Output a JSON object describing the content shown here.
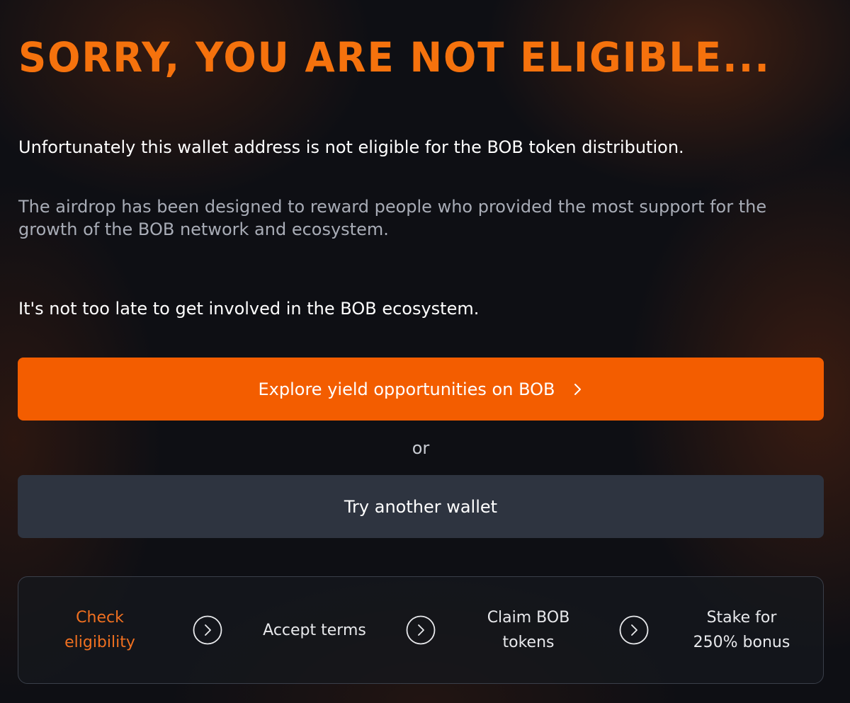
{
  "header": {
    "title": "SORRY, YOU ARE NOT ELIGIBLE..."
  },
  "content": {
    "lead": "Unfortunately this wallet address is not eligible for the BOB token distribution.",
    "explanation": "The airdrop has been designed to reward people who provided the most support for the growth of the BOB network and ecosystem.",
    "involve": "It's not too late to get involved in the BOB ecosystem."
  },
  "actions": {
    "primary_label": "Explore yield opportunities on BOB",
    "primary_icon": "chevron-right-icon",
    "or_label": "or",
    "secondary_label": "Try another wallet"
  },
  "steps": {
    "items": [
      {
        "line1": "Check",
        "line2": "eligibility",
        "state": "active"
      },
      {
        "line1": "Accept terms",
        "line2": "",
        "state": "inactive"
      },
      {
        "line1": "Claim BOB",
        "line2": "tokens",
        "state": "inactive"
      },
      {
        "line1": "Stake for",
        "line2": "250% bonus",
        "state": "inactive"
      }
    ],
    "separator_icon": "chevron-right-circle-icon"
  },
  "colors": {
    "accent": "#f35d00",
    "title": "#f5720d",
    "active_step": "#f07020",
    "secondary_button": "#2e3440",
    "background": "#0e0f14"
  }
}
